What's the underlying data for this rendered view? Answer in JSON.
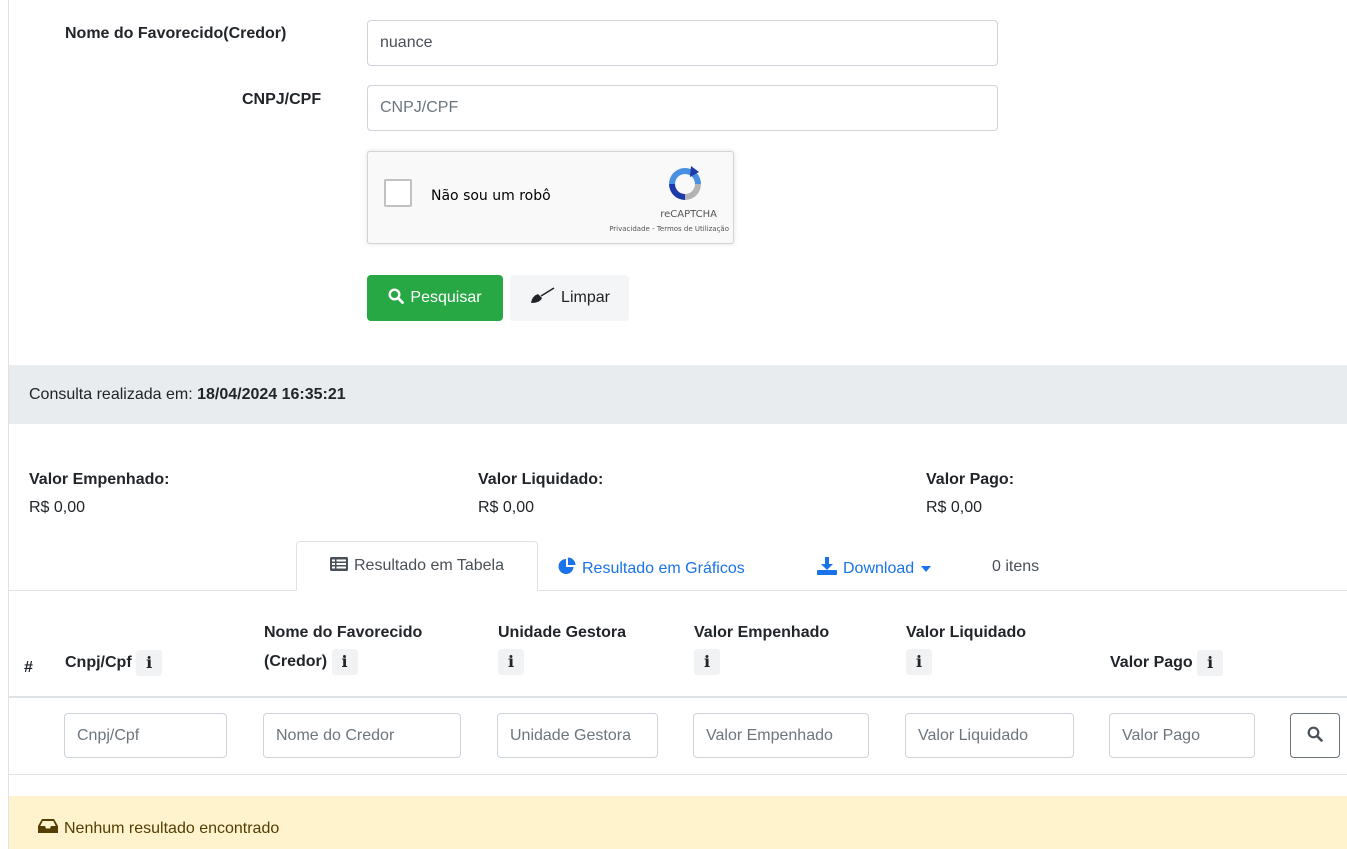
{
  "form": {
    "favorecido_label": "Nome do Favorecido(Credor)",
    "favorecido_value": "nuance",
    "cnpj_label": "CNPJ/CPF",
    "cnpj_placeholder": "CNPJ/CPF"
  },
  "captcha": {
    "label": "Não sou um robô",
    "brand": "reCAPTCHA",
    "privacy": "Privacidade",
    "separator": " - ",
    "terms": "Termos de Utilização"
  },
  "buttons": {
    "search_label": "Pesquisar",
    "clear_label": "Limpar"
  },
  "consulta": {
    "prefix": "Consulta realizada em: ",
    "datetime": "18/04/2024 16:35:21"
  },
  "summary": {
    "empenhado_label": "Valor Empenhado:",
    "empenhado_value": "R$ 0,00",
    "liquidado_label": "Valor Liquidado:",
    "liquidado_value": "R$ 0,00",
    "pago_label": "Valor Pago:",
    "pago_value": "R$ 0,00"
  },
  "tabs": {
    "table_label": "Resultado em Tabela",
    "charts_label": "Resultado em Gráficos",
    "download_label": "Download",
    "items_count": "0 itens"
  },
  "table": {
    "columns": {
      "hash": "#",
      "cnpj": "Cnpj/Cpf",
      "nome_line1": "Nome do Favorecido",
      "nome_line2": "(Credor)",
      "unidade": "Unidade Gestora",
      "empenhado": "Valor Empenhado",
      "liquidado": "Valor Liquidado",
      "pago": "Valor Pago"
    },
    "info_glyph": "i",
    "filters": {
      "cnpj": "Cnpj/Cpf",
      "nome": "Nome do Credor",
      "unidade": "Unidade Gestora",
      "empenhado": "Valor Empenhado",
      "liquidado": "Valor Liquidado",
      "pago": "Valor Pago"
    }
  },
  "alert": {
    "message": "Nenhum resultado encontrado"
  },
  "colors": {
    "primary_green": "#28a745",
    "link_blue": "#1a73e8",
    "alert_bg": "#fff3cd",
    "bar_bg": "#e9ecef"
  },
  "icons": {
    "search": "search-icon",
    "clear": "broom-icon",
    "table": "table-icon",
    "charts": "pie-chart-icon",
    "download": "download-icon",
    "caret": "caret-down-icon",
    "inbox": "inbox-icon",
    "recaptcha": "recaptcha-logo-icon"
  }
}
